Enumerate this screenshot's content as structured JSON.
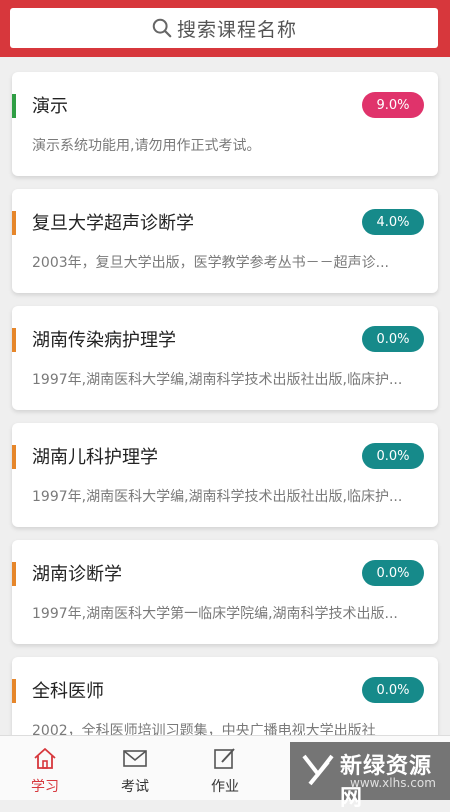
{
  "search": {
    "placeholder": "搜索课程名称",
    "icon": "search-icon"
  },
  "colors": {
    "header": "#d7373c",
    "badge_red": "#e0336b",
    "badge_teal": "#168a8a",
    "bar_green": "#2f9e44",
    "bar_orange": "#e6862a"
  },
  "courses": [
    {
      "title": "演示",
      "progress": "9.0%",
      "desc": "演示系统功能用,请勿用作正式考试。"
    },
    {
      "title": "复旦大学超声诊断学",
      "progress": "4.0%",
      "desc": "2003年，复旦大学出版，医学教学参考丛书－－超声诊..."
    },
    {
      "title": "湖南传染病护理学",
      "progress": "0.0%",
      "desc": "1997年,湖南医科大学编,湖南科学技术出版社出版,临床护..."
    },
    {
      "title": "湖南儿科护理学",
      "progress": "0.0%",
      "desc": "1997年,湖南医科大学编,湖南科学技术出版社出版,临床护..."
    },
    {
      "title": "湖南诊断学",
      "progress": "0.0%",
      "desc": "1997年,湖南医科大学第一临床学院编,湖南科学技术出版..."
    },
    {
      "title": "全科医师",
      "progress": "0.0%",
      "desc": "2002，全科医师培训习题集，中央广播电视大学出版社"
    }
  ],
  "tabs": [
    {
      "label": "学习",
      "icon": "home-icon",
      "active": true
    },
    {
      "label": "考试",
      "icon": "mail-icon"
    },
    {
      "label": "作业",
      "icon": "edit-icon"
    }
  ],
  "watermark": {
    "name": "新绿资源网",
    "url": "www.xlhs.com"
  }
}
